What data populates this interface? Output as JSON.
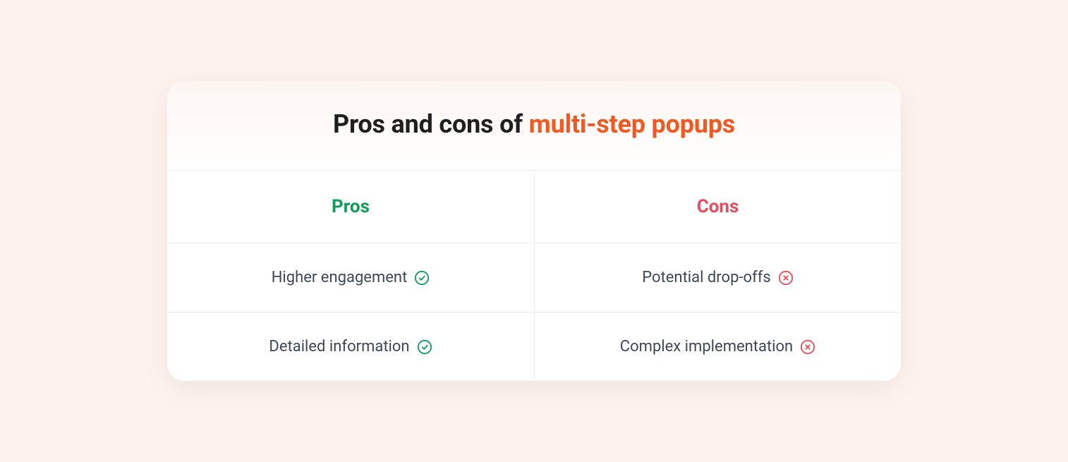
{
  "title_prefix": "Pros and cons of ",
  "title_accent": "multi-step popups",
  "columns": {
    "pros": "Pros",
    "cons": "Cons"
  },
  "rows": [
    {
      "pro": "Higher engagement",
      "con": "Potential drop-offs"
    },
    {
      "pro": "Detailed information",
      "con": "Complex implementation"
    }
  ],
  "colors": {
    "accent": "#f05a22",
    "pros": "#0f9d58",
    "cons": "#e74c5b"
  }
}
